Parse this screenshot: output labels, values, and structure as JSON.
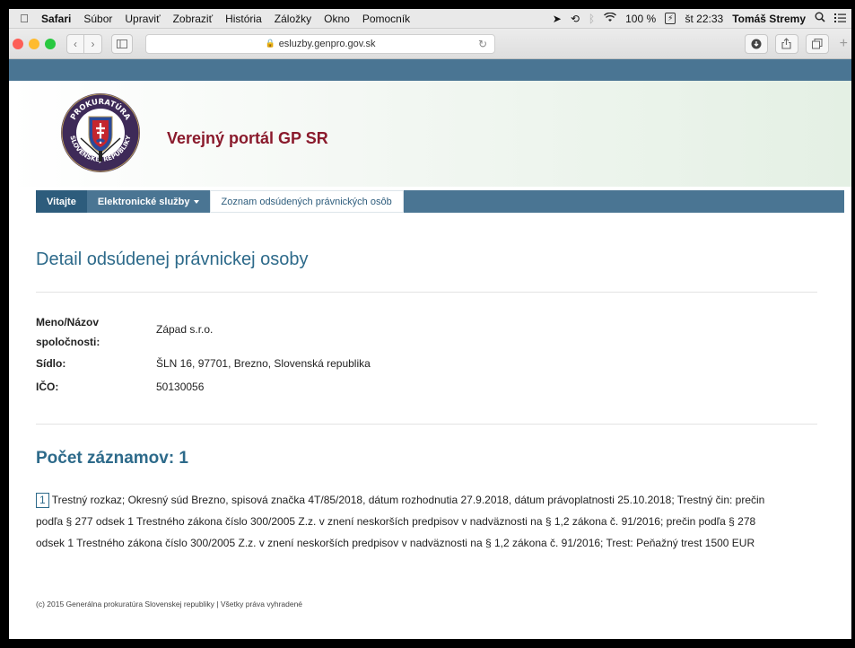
{
  "menubar": {
    "app": "Safari",
    "items": [
      "Súbor",
      "Upraviť",
      "Zobraziť",
      "História",
      "Záložky",
      "Okno",
      "Pomocník"
    ],
    "battery_label": "100 %",
    "battery_box": "⚡",
    "clock": "št 22:33",
    "user": "Tomáš Stremy"
  },
  "browser": {
    "url": "esluzby.genpro.gov.sk"
  },
  "site": {
    "title": "Verejný portál GP SR",
    "logo_text_top": "PROKURATÚRA",
    "logo_text_bottom": "SLOVENSKEJ REPUBLIKY"
  },
  "nav": {
    "items": [
      "Vitajte",
      "Elektronické služby",
      "Zoznam odsúdených právnických osôb"
    ]
  },
  "detail": {
    "heading": "Detail odsúdenej právnickej osoby",
    "name_label_1": "Meno/Názov",
    "name_label_2": "spoločnosti:",
    "name_value": "Západ s.r.o.",
    "seat_label": "Sídlo:",
    "seat_value": "ŠLN 16, 97701, Brezno, Slovenská republika",
    "ico_label": "IČO:",
    "ico_value": "50130056"
  },
  "records": {
    "heading": "Počet záznamov: 1",
    "items": [
      {
        "number": "1",
        "text_line1": "Trestný rozkaz; Okresný súd Brezno, spisová značka 4T/85/2018, dátum rozhodnutia 27.9.2018, dátum právoplatnosti 25.10.2018; Trestný čin: prečin",
        "text_line2": "podľa § 277 odsek 1 Trestného zákona číslo 300/2005 Z.z. v znení neskorších predpisov v nadväznosti na § 1,2 zákona č. 91/2016; prečin podľa § 278",
        "text_line3": "odsek 1 Trestného zákona číslo 300/2005 Z.z. v znení neskorších predpisov v nadväznosti na § 1,2 zákona č. 91/2016; Trest: Peňažný trest 1500 EUR"
      }
    ]
  },
  "footer": {
    "text": "(c) 2015 Generálna prokuratúra Slovenskej republiky | Všetky práva vyhradené"
  },
  "colors": {
    "brand_blue": "#4a7593",
    "heading_blue": "#2d6a8a",
    "title_red": "#8a1a2c"
  }
}
